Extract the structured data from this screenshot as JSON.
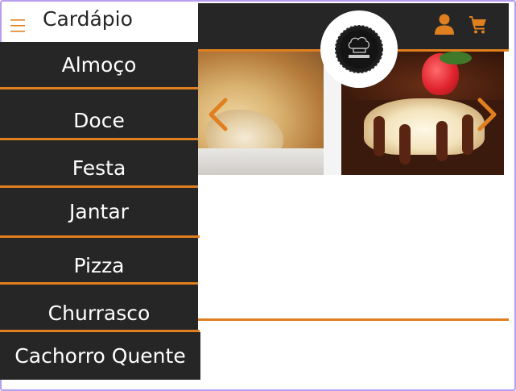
{
  "sidebar": {
    "title": "Cardápio",
    "menu_icon": "hamburger-menu-icon",
    "items": [
      {
        "label": "Almoço"
      },
      {
        "label": "Doce"
      },
      {
        "label": "Festa"
      },
      {
        "label": "Jantar"
      },
      {
        "label": "Pizza"
      },
      {
        "label": "Churrasco"
      },
      {
        "label": "Cachorro Quente"
      }
    ]
  },
  "header": {
    "icons": [
      "user-icon",
      "cart-icon"
    ],
    "logo": "restaurant-logo"
  },
  "carousel": {
    "prev_icon": "chevron-left-icon",
    "next_icon": "chevron-right-icon",
    "slides": [
      "savory-pie-image",
      "chocolate-cake-image"
    ]
  },
  "colors": {
    "accent": "#e07f1f",
    "dark": "#262626",
    "background": "#ffffff",
    "frame": "#b99ef0"
  }
}
